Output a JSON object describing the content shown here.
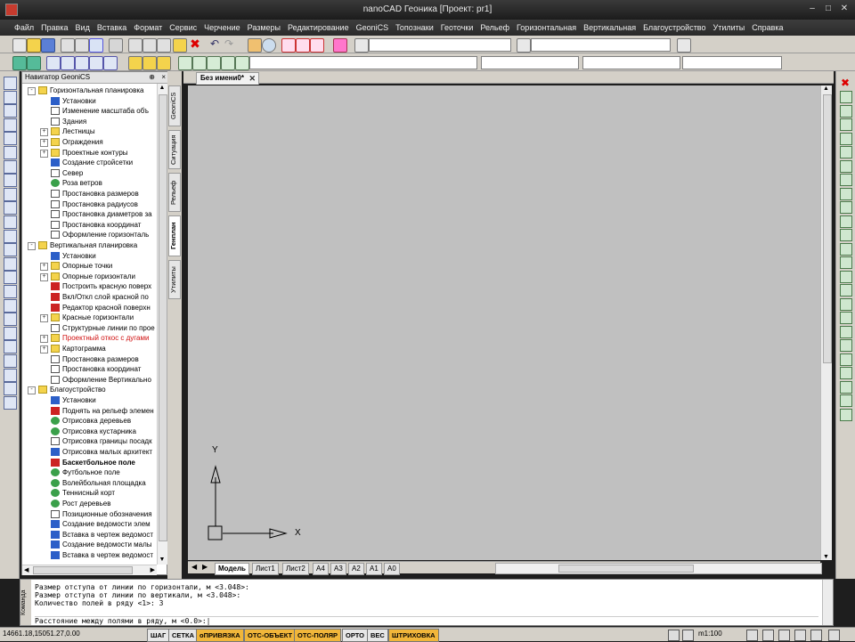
{
  "window": {
    "title": "nanoCAD Геоника [Проект: pr1]"
  },
  "menu": [
    "Файл",
    "Правка",
    "Вид",
    "Вставка",
    "Формат",
    "Сервис",
    "Черчение",
    "Размеры",
    "Редактирование",
    "GeoniCS",
    "Топознаки",
    "Геоточки",
    "Рельеф",
    "Горизонтальная",
    "Вертикальная",
    "Благоустройство",
    "Утилиты",
    "Справка"
  ],
  "navigator": {
    "title": "Навигатор GeoniCS",
    "items": [
      {
        "level": 0,
        "exp": "-",
        "icon": "folder-icon",
        "label": "Горизонтальная планировка"
      },
      {
        "level": 1,
        "exp": "",
        "icon": "settings-icon",
        "label": "Установки"
      },
      {
        "level": 1,
        "exp": "",
        "icon": "scale-icon",
        "label": "Изменение масштаба объ"
      },
      {
        "level": 1,
        "exp": "",
        "icon": "building-icon",
        "label": "Здания"
      },
      {
        "level": 1,
        "exp": "+",
        "icon": "folder-icon",
        "label": "Лестницы"
      },
      {
        "level": 1,
        "exp": "+",
        "icon": "folder-icon",
        "label": "Ограждения"
      },
      {
        "level": 1,
        "exp": "+",
        "icon": "folder-icon",
        "label": "Проектные контуры"
      },
      {
        "level": 1,
        "exp": "",
        "icon": "grid-icon",
        "label": "Создание стройсетки"
      },
      {
        "level": 1,
        "exp": "",
        "icon": "north-icon",
        "label": "Север"
      },
      {
        "level": 1,
        "exp": "",
        "icon": "wind-rose-icon",
        "label": "Роза ветров"
      },
      {
        "level": 1,
        "exp": "",
        "icon": "dimension-icon",
        "label": "Простановка размеров"
      },
      {
        "level": 1,
        "exp": "",
        "icon": "radius-icon",
        "label": "Простановка радиусов"
      },
      {
        "level": 1,
        "exp": "",
        "icon": "diameter-icon",
        "label": "Простановка диаметров за"
      },
      {
        "level": 1,
        "exp": "",
        "icon": "coordinate-icon",
        "label": "Простановка координат"
      },
      {
        "level": 1,
        "exp": "",
        "icon": "document-icon",
        "label": "Оформление горизонталь"
      },
      {
        "level": 0,
        "exp": "-",
        "icon": "folder-icon",
        "label": "Вертикальная планировка"
      },
      {
        "level": 1,
        "exp": "",
        "icon": "settings-icon",
        "label": "Установки"
      },
      {
        "level": 1,
        "exp": "+",
        "icon": "folder-icon",
        "label": "Опорные точки"
      },
      {
        "level": 1,
        "exp": "+",
        "icon": "folder-icon",
        "label": "Опорные горизонтали"
      },
      {
        "level": 1,
        "exp": "",
        "icon": "surface-icon",
        "label": "Построить красную поверх"
      },
      {
        "level": 1,
        "exp": "",
        "icon": "layer-icon",
        "label": "Вкл/Откл слой красной по"
      },
      {
        "level": 1,
        "exp": "",
        "icon": "surface-edit-icon",
        "label": "Редактор красной поверхн"
      },
      {
        "level": 1,
        "exp": "+",
        "icon": "folder-icon",
        "label": "Красные горизонтали"
      },
      {
        "level": 1,
        "exp": "",
        "icon": "structural-lines-icon",
        "label": "Структурные линии по прое"
      },
      {
        "level": 1,
        "exp": "+",
        "icon": "folder-icon",
        "label": "Проектный откос с дугами",
        "red": true
      },
      {
        "level": 1,
        "exp": "+",
        "icon": "folder-icon",
        "label": "Картограмма"
      },
      {
        "level": 1,
        "exp": "",
        "icon": "dimension-icon",
        "label": "Простановка размеров"
      },
      {
        "level": 1,
        "exp": "",
        "icon": "coordinate-icon",
        "label": "Простановка координат"
      },
      {
        "level": 1,
        "exp": "",
        "icon": "document-icon",
        "label": "Оформление Вертикально"
      },
      {
        "level": 0,
        "exp": "-",
        "icon": "folder-icon",
        "label": "Благоустройство"
      },
      {
        "level": 1,
        "exp": "",
        "icon": "settings-icon",
        "label": "Установки"
      },
      {
        "level": 1,
        "exp": "",
        "icon": "raise-icon",
        "label": "Поднять на рельеф элемен"
      },
      {
        "level": 1,
        "exp": "",
        "icon": "tree-icon",
        "label": "Отрисовка деревьев"
      },
      {
        "level": 1,
        "exp": "",
        "icon": "shrub-icon",
        "label": "Отрисовка кустарника"
      },
      {
        "level": 1,
        "exp": "",
        "icon": "boundary-icon",
        "label": "Отрисовка границы посадк"
      },
      {
        "level": 1,
        "exp": "",
        "icon": "small-arch-icon",
        "label": "Отрисовка малых архитект"
      },
      {
        "level": 1,
        "exp": "",
        "icon": "basketball-icon",
        "label": "Баскетбольное поле",
        "bold": true
      },
      {
        "level": 1,
        "exp": "",
        "icon": "football-icon",
        "label": "Футбольное поле"
      },
      {
        "level": 1,
        "exp": "",
        "icon": "volleyball-icon",
        "label": "Волейбольная площадка"
      },
      {
        "level": 1,
        "exp": "",
        "icon": "tennis-icon",
        "label": "Теннисный корт"
      },
      {
        "level": 1,
        "exp": "",
        "icon": "tree-growth-icon",
        "label": "Рост деревьев"
      },
      {
        "level": 1,
        "exp": "",
        "icon": "legend-icon",
        "label": "Позиционные обозначения"
      },
      {
        "level": 1,
        "exp": "",
        "icon": "table-icon",
        "label": "Создание ведомости элем"
      },
      {
        "level": 1,
        "exp": "",
        "icon": "table-insert-icon",
        "label": "Вставка в чертеж ведомост"
      },
      {
        "level": 1,
        "exp": "",
        "icon": "table-icon",
        "label": "Создание ведомости малы"
      },
      {
        "level": 1,
        "exp": "",
        "icon": "table-insert-icon",
        "label": "Вставка в чертеж ведомост"
      }
    ]
  },
  "side_tabs": [
    "GeoniCS",
    "Ситуация",
    "Рельеф",
    "Генплан",
    "Утилиты"
  ],
  "active_side_tab": "Генплан",
  "document": {
    "tab": "Без имени0*",
    "axis_x": "X",
    "axis_y": "Y"
  },
  "sheets": [
    "Модель",
    "Лист1",
    "Лист2",
    "A4",
    "A3",
    "A2",
    "A1",
    "A0"
  ],
  "command": {
    "lines": [
      "Размер отступа от линии по горизонтали, м <3.048>:",
      "Размер отступа от линии по вертикали, м <3.048>:",
      "Количество полей в ряду <1>: 3"
    ],
    "prompt": "Расстояние между полями в ряду, м <0.0>:",
    "side_label": "Команда"
  },
  "status": {
    "coords": "14661.18,15051.27,0.00",
    "buttons": [
      {
        "label": "ШАГ",
        "on": false
      },
      {
        "label": "СЕТКА",
        "on": false
      },
      {
        "label": "оПРИВЯЗКА",
        "on": true
      },
      {
        "label": "ОТС-ОБЪЕКТ",
        "on": true
      },
      {
        "label": "ОТС-ПОЛЯР",
        "on": true
      },
      {
        "label": "ОРТО",
        "on": false
      },
      {
        "label": "ВЕС",
        "on": false
      },
      {
        "label": "ШТРИХОВКА",
        "on": true
      }
    ],
    "scale": "m1:100"
  }
}
